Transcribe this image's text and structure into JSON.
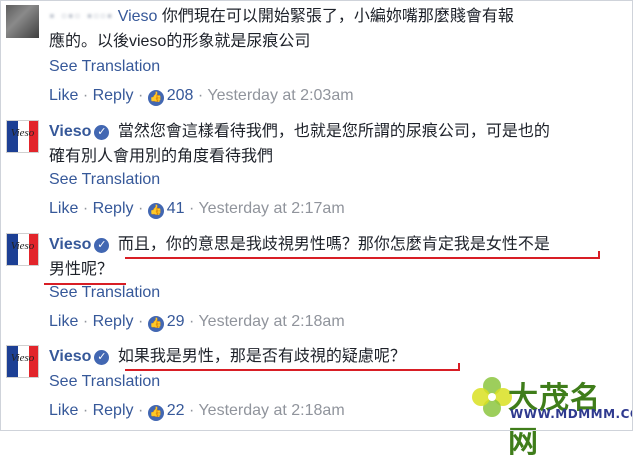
{
  "comments": [
    {
      "author": "Vieso",
      "text_line1": "你們現在可以開始緊張了，小編妳嘴那麼賤會有報",
      "text_line2": "應的。以後vieso的形象就是尿痕公司",
      "see_translation": "See Translation",
      "like": "Like",
      "reply": "Reply",
      "reactions": "208",
      "time": "Yesterday at 2:03am"
    },
    {
      "author": "Vieso",
      "text_line1": "當然您會這樣看待我們，也就是您所謂的尿痕公司，可是也的",
      "text_line2": "確有別人會用別的角度看待我們",
      "see_translation": "See Translation",
      "like": "Like",
      "reply": "Reply",
      "reactions": "41",
      "time": "Yesterday at 2:17am"
    },
    {
      "author": "Vieso",
      "text_line1": "而且，你的意思是我歧視男性嗎？那你怎麼肯定我是女性不是",
      "text_line2": "男性呢？",
      "see_translation": "See Translation",
      "like": "Like",
      "reply": "Reply",
      "reactions": "29",
      "time": "Yesterday at 2:18am"
    },
    {
      "author": "Vieso",
      "text_line1": "如果我是男性，那是否有歧視的疑慮呢？",
      "see_translation": "See Translation",
      "like": "Like",
      "reply": "Reply",
      "reactions": "22",
      "time": "Yesterday at 2:18am"
    }
  ],
  "separator": "·",
  "redacted_name": "▪ ▫▪▫ ▪▫▫▪",
  "avatar_logo": "Vieso",
  "watermark": {
    "title": "大茂名网",
    "url": "WWW.MDMMM.COM"
  },
  "colors": {
    "link": "#365899",
    "meta": "#90949c",
    "underline": "#d81e25"
  }
}
